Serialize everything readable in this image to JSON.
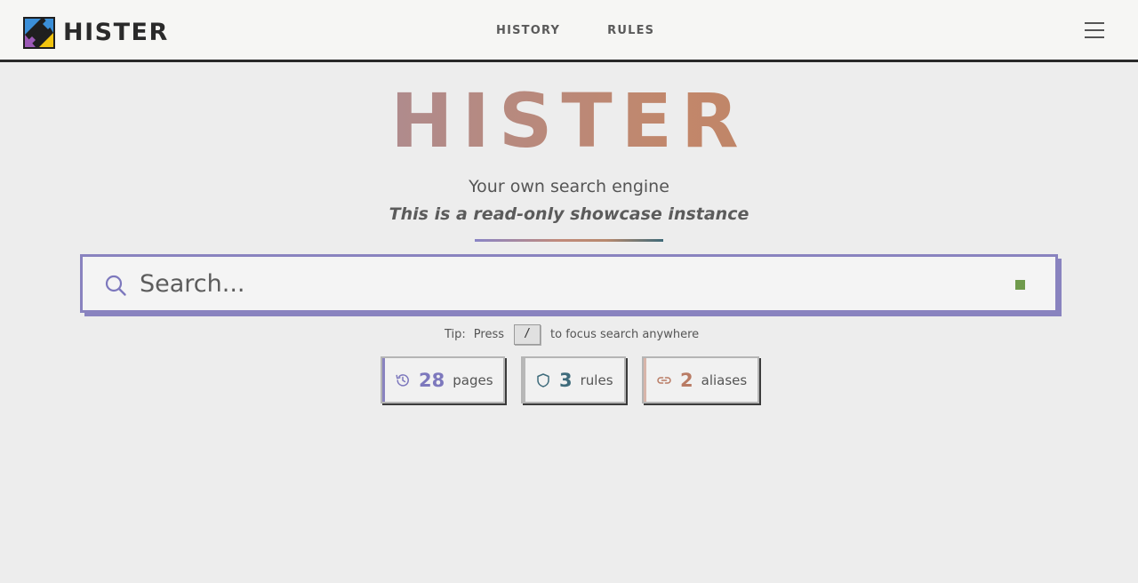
{
  "header": {
    "brand": "HISTER",
    "nav": [
      {
        "label": "HISTORY"
      },
      {
        "label": "RULES"
      }
    ],
    "menu_icon": "hamburger-menu-icon"
  },
  "hero": {
    "title": "HISTER",
    "tagline": "Your own search engine",
    "notice": "This is a read-only showcase instance"
  },
  "search": {
    "placeholder": "Search...",
    "value": "",
    "icon": "search-icon",
    "status_color": "#6f9a4c"
  },
  "tip": {
    "label": "Tip:",
    "press": "Press",
    "key": "/",
    "suffix": "to focus search anywhere"
  },
  "stats": [
    {
      "icon": "history-icon",
      "value": "28",
      "label": "pages",
      "color": "#7d78bd"
    },
    {
      "icon": "shield-icon",
      "value": "3",
      "label": "rules",
      "color": "#3f6c7c"
    },
    {
      "icon": "link-icon",
      "value": "2",
      "label": "aliases",
      "color": "#b97b64"
    }
  ],
  "colors": {
    "accent": "#8983bf",
    "header_border": "#2a2a2a"
  }
}
